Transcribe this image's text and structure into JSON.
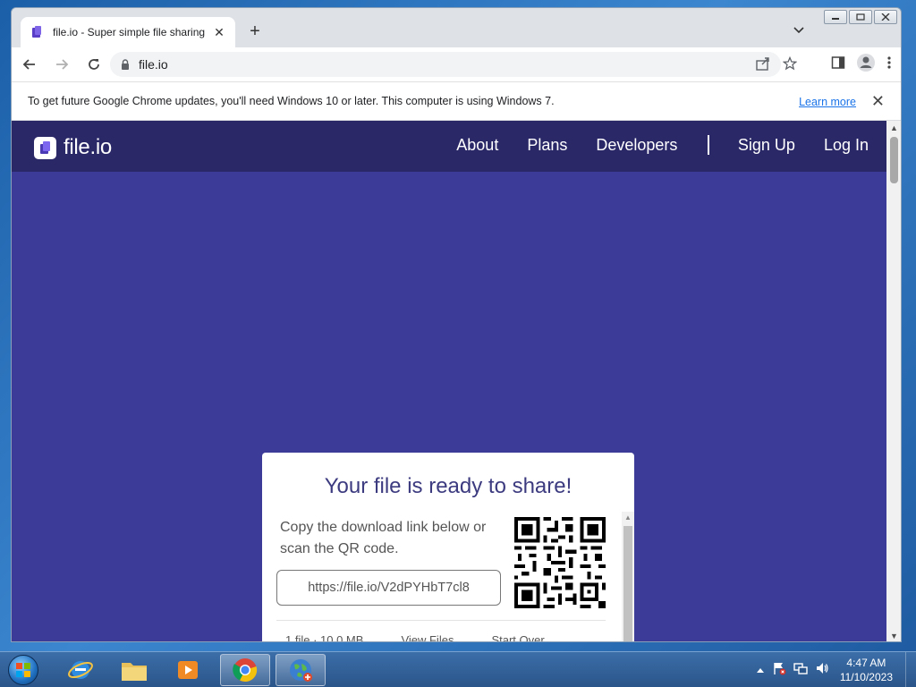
{
  "browser": {
    "tab_title": "file.io - Super simple file sharing",
    "tab_close": "✕",
    "new_tab": "+",
    "address": "file.io"
  },
  "infobar": {
    "message": "To get future Google Chrome updates, you'll need Windows 10 or later. This computer is using Windows 7.",
    "link": "Learn more",
    "close": "✕"
  },
  "site": {
    "logo_text": "file.io",
    "nav": [
      "About",
      "Plans",
      "Developers",
      "Sign Up",
      "Log In"
    ]
  },
  "card": {
    "title": "Your file is ready to share!",
    "instructions": "Copy the download link below or scan the QR code.",
    "link": "https://file.io/V2dPYHbT7cl8",
    "footer": [
      "1 file · 10.0 MB",
      "View Files",
      "Start Over"
    ]
  },
  "taskbar": {
    "time": "4:47 AM",
    "date": "11/10/2023"
  },
  "colors": {
    "page_bg": "#3d3b98",
    "header_bg": "#2b2868",
    "title_color": "#3d3b80"
  }
}
